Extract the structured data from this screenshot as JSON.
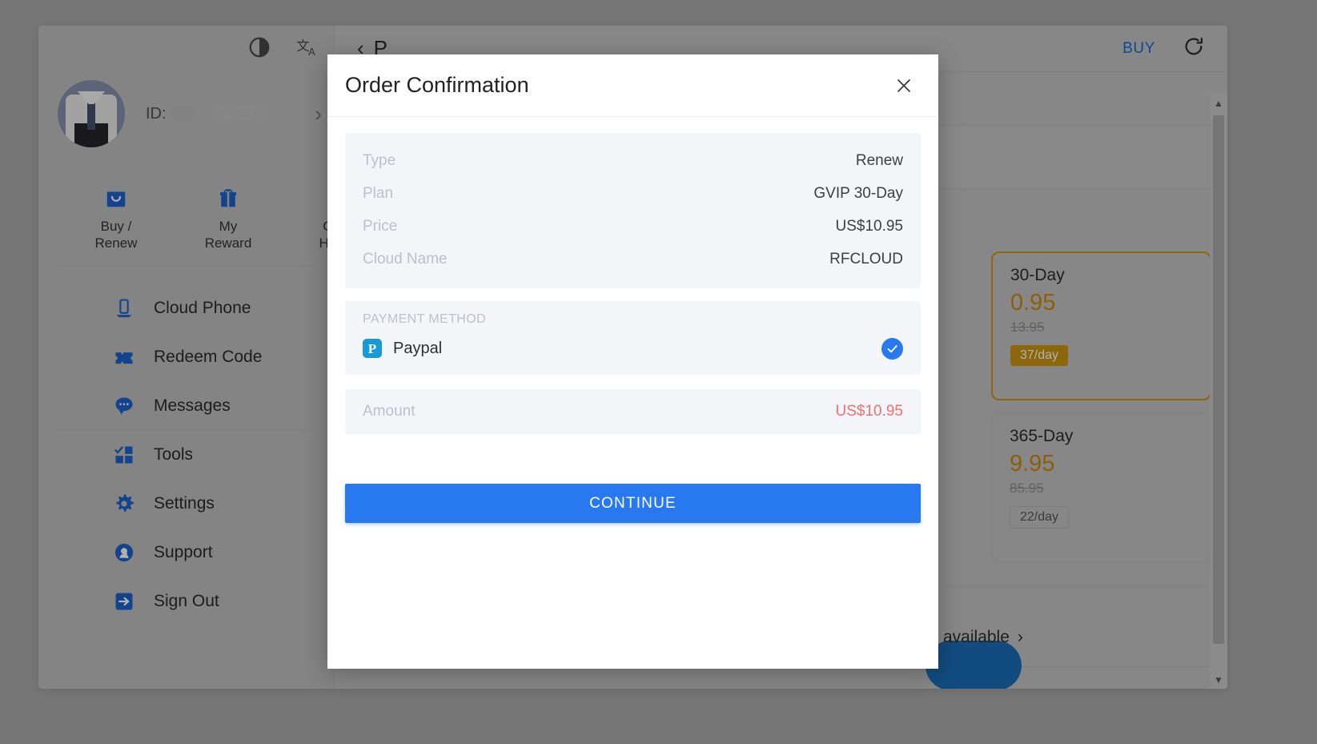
{
  "app": {
    "sidebar": {
      "top_icons": [
        {
          "name": "contrast-icon",
          "label": "Theme"
        },
        {
          "name": "translate-icon",
          "label": "Language"
        }
      ],
      "profile": {
        "id_label": "ID:",
        "id_value": "",
        "chevron": "›"
      },
      "quick_tabs": [
        {
          "label": "Buy /\nRenew",
          "line1": "Buy /",
          "line2": "Renew",
          "icon": "shopping-bag-icon"
        },
        {
          "label": "My Reward",
          "line1": "My",
          "line2": "Reward",
          "icon": "gift-icon"
        },
        {
          "label": "Order History",
          "line1": "Order",
          "line2": "History",
          "icon": "clipboard-icon"
        }
      ],
      "menu": [
        {
          "label": "Cloud Phone",
          "icon": "cloud-phone-icon"
        },
        {
          "label": "Redeem Code",
          "icon": "ticket-icon"
        },
        {
          "label": "Messages",
          "icon": "chat-bubble-icon"
        },
        {
          "label": "Tools",
          "icon": "tools-grid-icon"
        },
        {
          "label": "Settings",
          "icon": "gear-icon"
        },
        {
          "label": "Support",
          "icon": "support-agent-icon"
        },
        {
          "label": "Sign Out",
          "icon": "sign-out-icon"
        }
      ]
    },
    "header": {
      "back_chevron": "‹",
      "title": "P",
      "buy_label": "BUY",
      "refresh_icon": "refresh-icon"
    },
    "plans": [
      {
        "name": "30-Day",
        "price": "0.95",
        "old_price": "13.95",
        "badge": "37/day",
        "selected": true
      },
      {
        "name": "365-Day",
        "price": "9.95",
        "old_price": "85.95",
        "badge": "22/day",
        "selected": false
      }
    ],
    "availability": {
      "text": "available",
      "chevron": "›"
    }
  },
  "modal": {
    "title": "Order Confirmation",
    "close_icon": "close-icon",
    "details": [
      {
        "key": "Type",
        "value": "Renew"
      },
      {
        "key": "Plan",
        "value": "GVIP 30-Day"
      },
      {
        "key": "Price",
        "value": "US$10.95"
      },
      {
        "key": "Cloud Name",
        "value": "RFCLOUD"
      }
    ],
    "payment": {
      "section_title": "PAYMENT METHOD",
      "method_name": "Paypal",
      "method_icon": "paypal-icon",
      "selected": true,
      "check_icon": "check-circle-icon"
    },
    "amount": {
      "key": "Amount",
      "value": "US$10.95"
    },
    "continue_label": "CONTINUE"
  },
  "colors": {
    "primary": "#2878f0",
    "accent_gold": "#c99211",
    "amount_red": "#f07070",
    "muted_label": "#bcc0cb"
  }
}
